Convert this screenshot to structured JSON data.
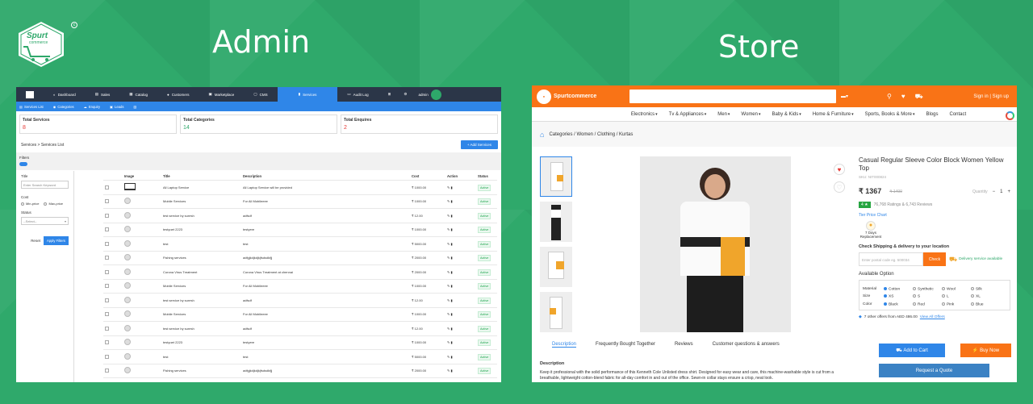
{
  "headings": {
    "admin": "Admin",
    "store": "Store"
  },
  "logo": {
    "line1": "Spurt",
    "line2": "commerce",
    "mark": "c"
  },
  "admin": {
    "tabs": [
      "Dashboard",
      "Sales",
      "Catalog",
      "Customers",
      "Marketplace",
      "CMS",
      "Services",
      "Audit Log"
    ],
    "user": "admin",
    "subtabs": [
      "Services List",
      "Categories",
      "Enquiry",
      "Leads"
    ],
    "cards": [
      {
        "title": "Total Services",
        "value": "8"
      },
      {
        "title": "Total Categories",
        "value": "14"
      },
      {
        "title": "Total Enquires",
        "value": "2"
      }
    ],
    "breadcrumb": "Services  >  Services List",
    "add_button": "+ Add Services",
    "filters_label": "Filters",
    "filter_title": "Title",
    "filter_placeholder": "Enter Search Keyword",
    "cost_label": "Cost",
    "cost_opts": [
      "Min-price",
      "Max-price"
    ],
    "status_label": "Status",
    "status_select": "--Select--",
    "reset": "Reset",
    "apply": "Apply Filters",
    "columns": [
      "Image",
      "Title",
      "Description",
      "Cost",
      "Action",
      "Status"
    ],
    "rows": [
      [
        "All Laptop Service",
        "All Laptop Service will be provided",
        "₹ 1000.00"
      ],
      [
        "Mobile Services",
        "For All Mobileeee",
        "₹ 1000.00"
      ],
      [
        "test service by suresh",
        "adfsdf",
        "₹ 12.00"
      ],
      [
        "testyuet 2223",
        "testyere",
        "₹ 1000.00"
      ],
      [
        "test",
        "test",
        "₹ 5000.00"
      ],
      [
        "Fishing services",
        "adfgjkdjkdjkjfsdsdkfjj",
        "₹ 2000.00"
      ],
      [
        "Corona Virus Treatment",
        "Corona Virus Treatment at chennai",
        "₹ 2000.00"
      ],
      [
        "Mobile Services",
        "For All Mobileeee",
        "₹ 1000.00"
      ],
      [
        "test service by suresh",
        "adfsdf",
        "₹ 12.00"
      ],
      [
        "Mobile Services",
        "For All Mobileeee",
        "₹ 1000.00"
      ],
      [
        "test service by suresh",
        "adfsdf",
        "₹ 12.00"
      ],
      [
        "testyuet 2223",
        "testyere",
        "₹ 1000.00"
      ],
      [
        "test",
        "test",
        "₹ 5000.00"
      ],
      [
        "Fishing services",
        "adfgjkdjkdjkjfsdsdkfjj",
        "₹ 2000.00"
      ]
    ],
    "status": "Active"
  },
  "store": {
    "brand": "Spurtcommerce",
    "signin": "Sign in | Sign up",
    "nav": [
      "Electronics",
      "Tv & Appliances",
      "Men",
      "Women",
      "Baby & Kids",
      "Home & Furniture",
      "Sports, Books & More",
      "Blogs",
      "Contact"
    ],
    "crumb": "Categories / Women / Clothing / Kurtas",
    "title": "Casual Regular Sleeve Color Block Women Yellow Top",
    "sku": "SKU: NIT000824",
    "price": "₹ 1367",
    "old_price": "₹ 1400",
    "qty_label": "Quantity",
    "qty": "1",
    "rating": "4 ★",
    "ratings_text": "76,768 Ratings & 6,743 Reviews",
    "size_chart": "Tier Price Chart",
    "replace": "7 Days Replacement",
    "check_title": "Check Shipping & delivery to your location",
    "pin_placeholder": "Enter postal code eg. 500034",
    "check_btn": "Check",
    "delivery": "Delivery service available",
    "avail": "Available Option",
    "options": [
      {
        "label": "Material",
        "vals": [
          "Cotton",
          "Synthetic",
          "Wool",
          "Silk"
        ]
      },
      {
        "label": "Size",
        "vals": [
          "XS",
          "S",
          "L",
          "XL"
        ]
      },
      {
        "label": "Color",
        "vals": [
          "Black",
          "Red",
          "Pink",
          "Blue"
        ]
      }
    ],
    "offers": "7 other offers from AED 486.00",
    "view_offers": "View All Offers",
    "add_cart": "Add to Cart",
    "buy_now": "Buy Now",
    "quote": "Request a Quote",
    "tabs": [
      "Description",
      "Frequently Bought Together",
      "Reviews",
      "Customer questions & answers"
    ],
    "desc_title": "Description",
    "desc_text": "Keep it professional with the solid performance of this Kenneth Cole Unlisted dress shirt. Designed for easy wear and care, this machine-washable style is cut from a breathable, lightweight cotton-blend fabric for all-day comfort in and out of the office. Sewn-in collar stays ensure a crisp, neat look."
  }
}
